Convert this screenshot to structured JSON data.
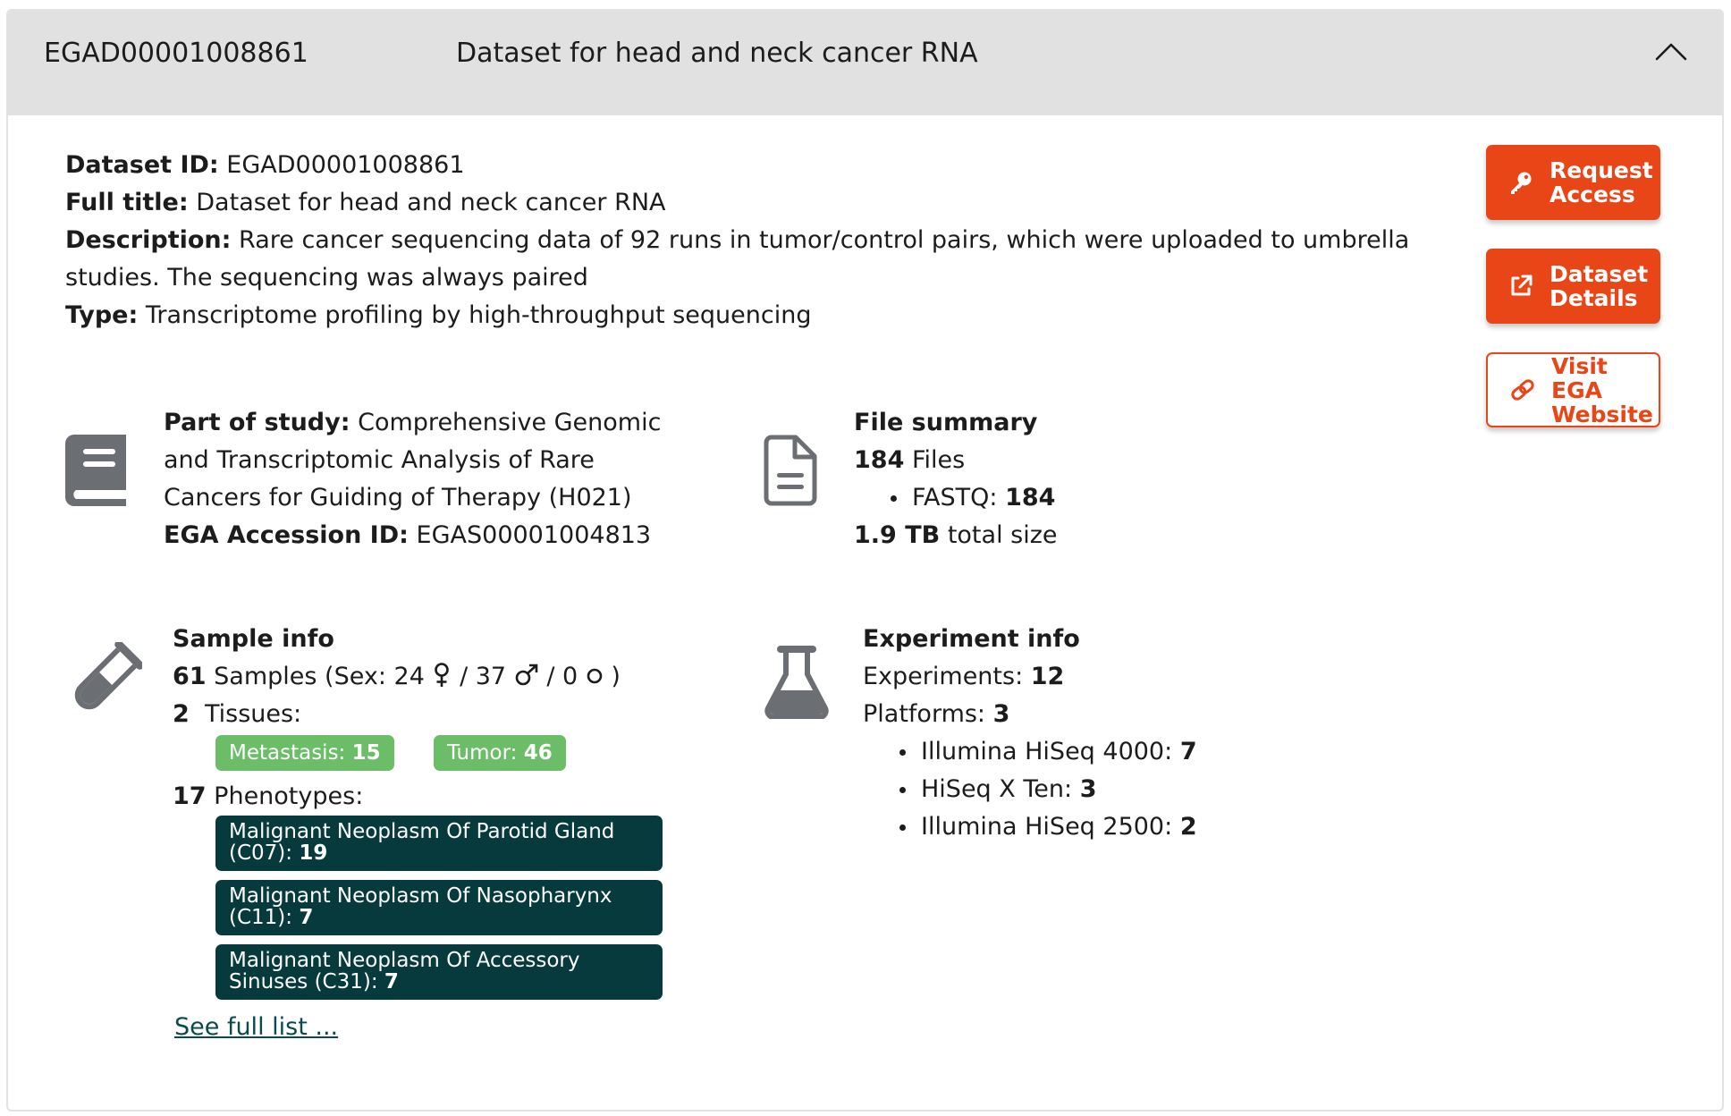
{
  "header": {
    "dataset_id": "EGAD00001008861",
    "title": "Dataset for head and neck cancer RNA",
    "collapse_icon": "chevron-up-icon"
  },
  "meta": {
    "dataset_id_label": "Dataset ID:",
    "dataset_id_value": "EGAD00001008861",
    "full_title_label": "Full title:",
    "full_title_value": "Dataset for head and neck cancer RNA",
    "description_label": "Description:",
    "description_value": "Rare cancer sequencing data of 92 runs in tumor/control pairs, which were uploaded to umbrella studies. The sequencing was always paired",
    "type_label": "Type:",
    "type_value": "Transcriptome profiling by high-throughput sequencing"
  },
  "actions": {
    "request_access": "Request Access",
    "request_access_icon": "key-icon",
    "dataset_details": "Dataset Details",
    "dataset_details_icon": "external-link-icon",
    "visit_ega": "Visit EGA Website",
    "visit_ega_icon": "link-icon"
  },
  "study": {
    "icon": "book-icon",
    "part_label": "Part of study:",
    "part_value": "Comprehensive Genomic and Transcriptomic Analysis of Rare Cancers for Guiding of Therapy (H021)",
    "accession_label": "EGA Accession ID:",
    "accession_value": "EGAS00001004813"
  },
  "files": {
    "icon": "file-icon",
    "heading": "File summary",
    "count": "184",
    "count_suffix": "Files",
    "types": [
      {
        "label": "FASTQ:",
        "value": "184"
      }
    ],
    "size": "1.9 TB",
    "size_suffix": "total size"
  },
  "samples": {
    "icon": "test-tube-icon",
    "heading": "Sample info",
    "count": "61",
    "count_text": "Samples (Sex: 24",
    "female_icon": "female-icon",
    "male_count_text": "/ 37",
    "male_icon": "male-icon",
    "unknown_count_text": "/ 0",
    "unknown_icon": "circle-icon",
    "close_paren": ")",
    "tissue_count": "2",
    "tissue_label": "Tissues:",
    "tissues": [
      {
        "label": "Metastasis:",
        "value": "15"
      },
      {
        "label": "Tumor:",
        "value": "46"
      }
    ],
    "phenotype_count": "17",
    "phenotype_label": "Phenotypes:",
    "phenotypes": [
      {
        "label": "Malignant Neoplasm Of Parotid Gland (C07):",
        "value": "19"
      },
      {
        "label": "Malignant Neoplasm Of Nasopharynx (C11):",
        "value": "7"
      },
      {
        "label": "Malignant Neoplasm Of Accessory Sinuses (C31):",
        "value": "7"
      }
    ],
    "see_full": "See full list ..."
  },
  "experiments": {
    "icon": "flask-icon",
    "heading": "Experiment info",
    "experiments_label": "Experiments:",
    "experiments_value": "12",
    "platforms_label": "Platforms:",
    "platforms_value": "3",
    "platforms": [
      {
        "label": "Illumina HiSeq 4000:",
        "value": "7"
      },
      {
        "label": "HiSeq X Ten:",
        "value": "3"
      },
      {
        "label": "Illumina HiSeq 2500:",
        "value": "2"
      }
    ]
  },
  "colors": {
    "accent": "#e94617",
    "header_bg": "#e1e1e1",
    "tag_green": "#6cbd67",
    "tag_dark": "#063a3c",
    "icon_gray": "#6b6e72"
  }
}
